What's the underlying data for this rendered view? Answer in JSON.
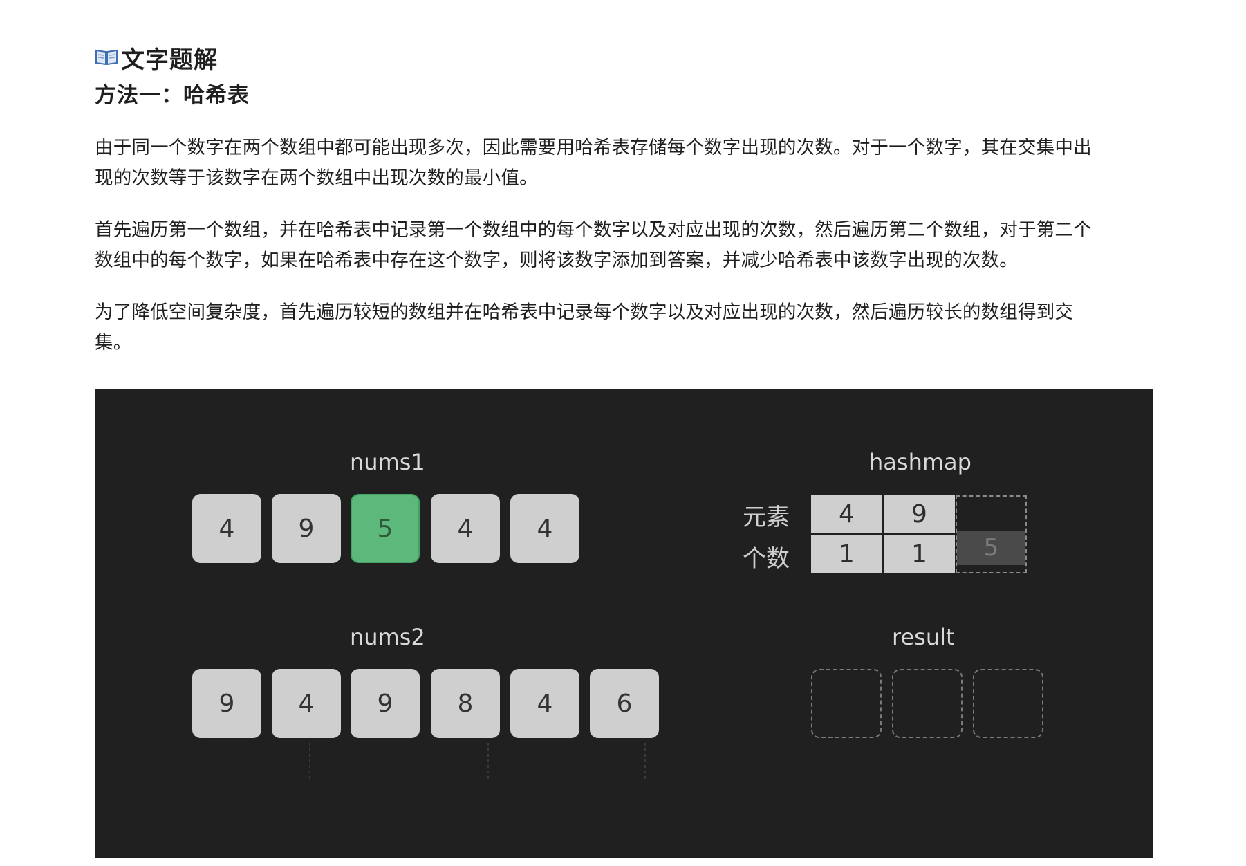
{
  "heading": {
    "title": "文字题解",
    "icon": "open-book-icon"
  },
  "method": {
    "subtitle": "方法一：哈希表"
  },
  "paragraphs": [
    {
      "line1": "由于同一个数字在两个数组中都可能出现多次，因此需要用哈希表存储每个数字出现的次数。对于一个数字，其在交集中出",
      "line2": "现的次数等于该数字在两个数组中出现次数的最小值。"
    },
    {
      "line1": "首先遍历第一个数组，并在哈希表中记录第一个数组中的每个数字以及对应出现的次数，然后遍历第二个数组，对于第二个",
      "line2": "数组中的每个数字，如果在哈希表中存在这个数字，则将该数字添加到答案，并减少哈希表中该数字出现的次数。"
    },
    {
      "line1": "为了降低空间复杂度，首先遍历较短的数组并在哈希表中记录每个数字以及对应出现的次数，然后遍历较长的数组得到交",
      "line2": "集。"
    }
  ],
  "animation": {
    "nums1": {
      "label": "nums1",
      "values": [
        "4",
        "9",
        "5",
        "4",
        "4"
      ],
      "active_index": 2
    },
    "nums2": {
      "label": "nums2",
      "values": [
        "9",
        "4",
        "9",
        "8",
        "4",
        "6"
      ]
    },
    "hashmap": {
      "label": "hashmap",
      "row_labels": {
        "element": "元素",
        "count": "个数"
      },
      "elements": [
        "4",
        "9"
      ],
      "counts": [
        "1",
        "1"
      ],
      "incoming": "5"
    },
    "result": {
      "label": "result",
      "slots": 3
    },
    "colors": {
      "background": "#202020",
      "cell": "#cfcfcf",
      "active": "#5db87b"
    }
  }
}
